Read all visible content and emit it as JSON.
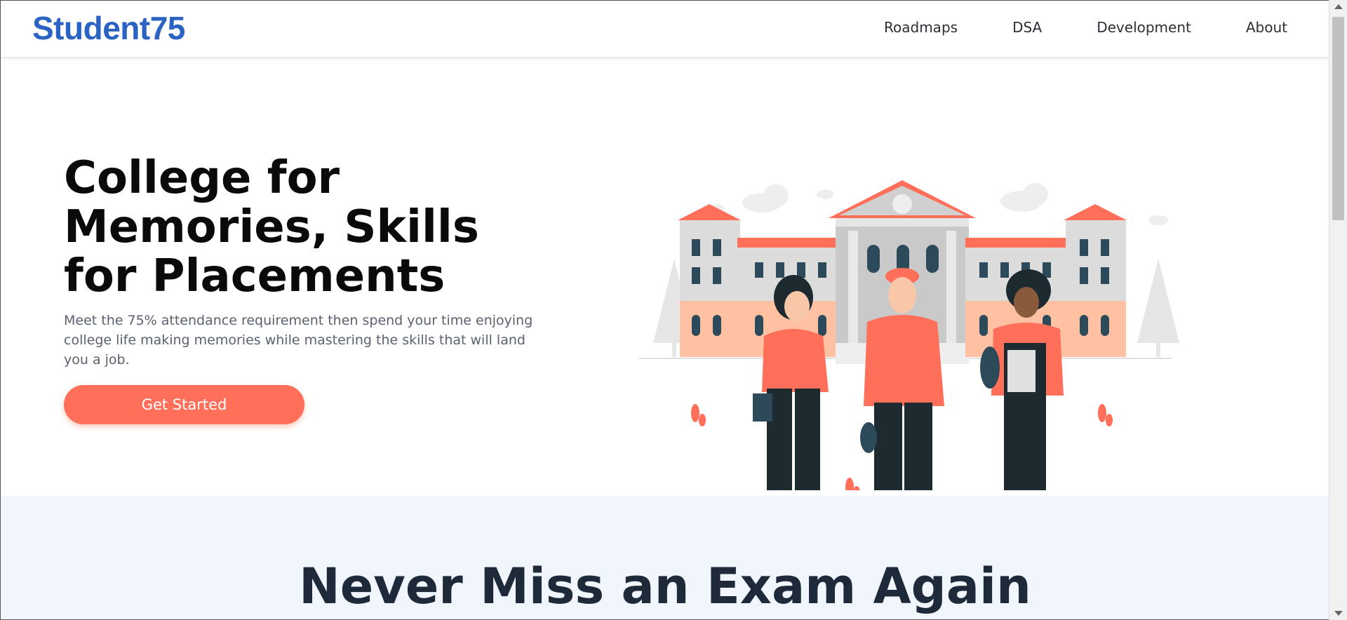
{
  "brand": {
    "name": "Student75"
  },
  "nav": {
    "items": [
      "Roadmaps",
      "DSA",
      "Development",
      "About"
    ]
  },
  "hero": {
    "title": "College for Memories, Skills for Placements",
    "subtitle": "Meet the 75% attendance requirement then spend your time enjoying college life making memories while mastering the skills that will land you a job.",
    "cta_label": "Get Started",
    "illustration": "students-in-front-of-college-illustration"
  },
  "section2": {
    "heading": "Never Miss an Exam Again"
  },
  "colors": {
    "brand": "#2a63c4",
    "accent": "#ff6f59",
    "heading": "#0a0a0a",
    "section_bg": "#f1f6fd"
  }
}
